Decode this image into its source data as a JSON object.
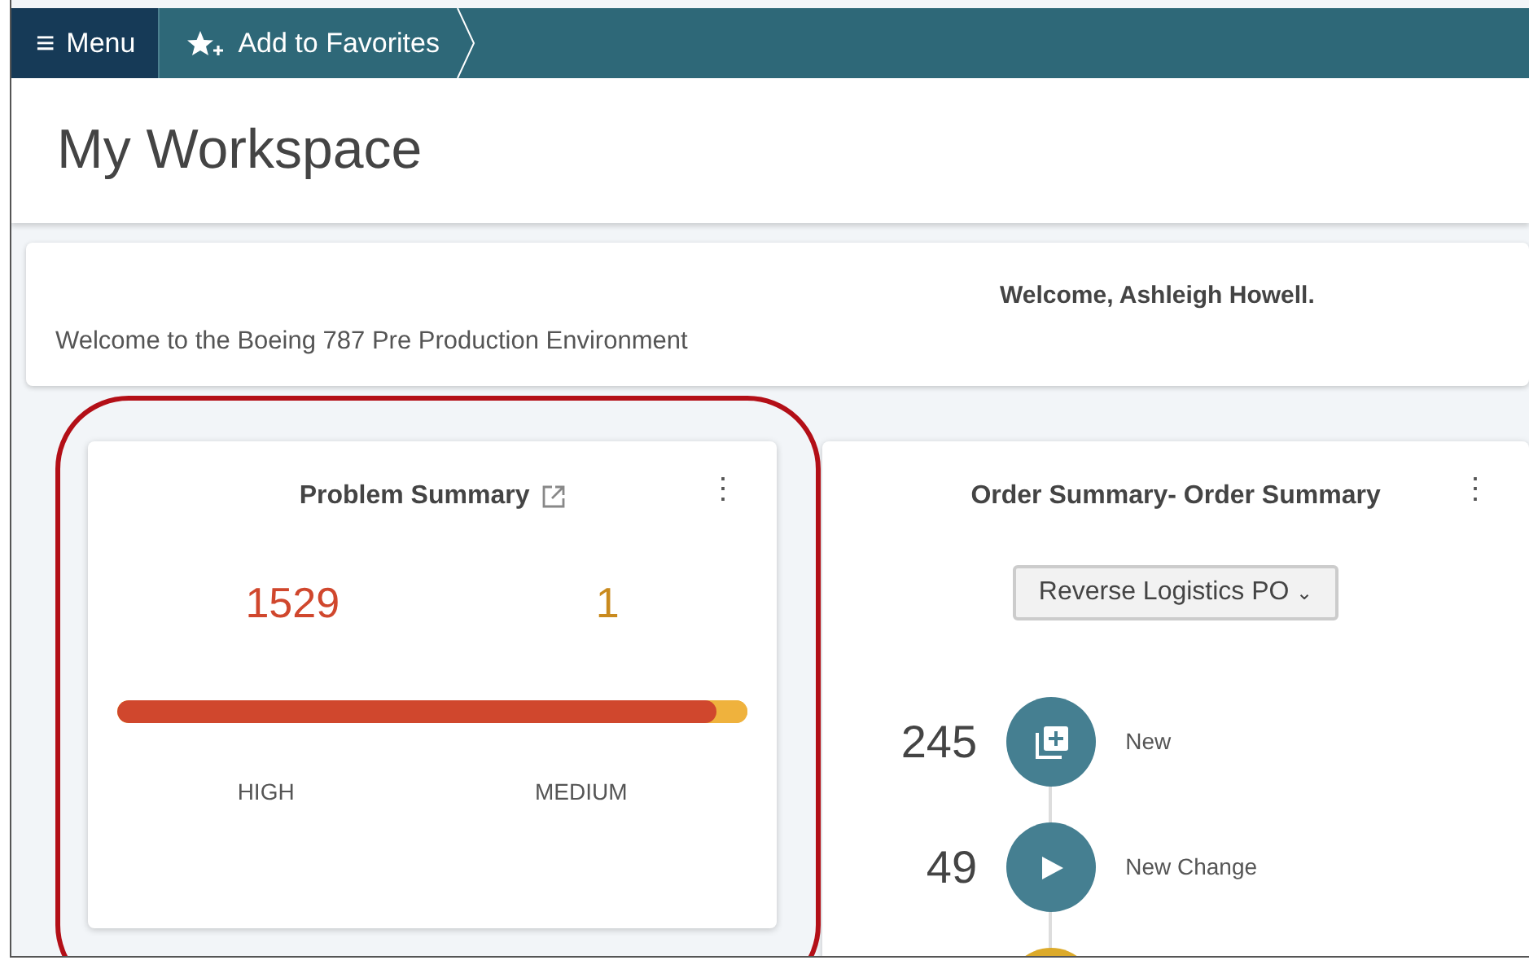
{
  "topbar": {
    "menu": {
      "icon": "≡",
      "label": "Menu"
    },
    "favorites": {
      "label": "Add to Favorites"
    }
  },
  "header": {
    "title": "My Workspace"
  },
  "welcome": {
    "greeting": "Welcome, Ashleigh Howell.",
    "message": "Welcome to the Boeing 787 Pre Production Environment"
  },
  "problem_summary": {
    "title": "Problem Summary",
    "menu_icon": "⋮",
    "segments": [
      {
        "count": "1529",
        "label": "HIGH",
        "level": 0.95,
        "color": "#d0472d"
      },
      {
        "count": "1",
        "label": "MEDIUM",
        "level": 0.05,
        "color": "#efb23d"
      }
    ]
  },
  "order_summary": {
    "title": "Order Summary- Order Summary",
    "menu_icon": "⋮",
    "dropdown": {
      "value": "Reverse Logistics PO",
      "caret": "⌄"
    },
    "steps": [
      {
        "kind": "add",
        "count": "245",
        "label": "New",
        "color": "#457f91"
      },
      {
        "kind": "play",
        "count": "49",
        "label": "New Change",
        "color": "#457f91"
      },
      {
        "kind": "plain",
        "color": "#dcaa2a"
      }
    ]
  },
  "annotation": {
    "kind": "highlight",
    "color": "#b30f17"
  }
}
